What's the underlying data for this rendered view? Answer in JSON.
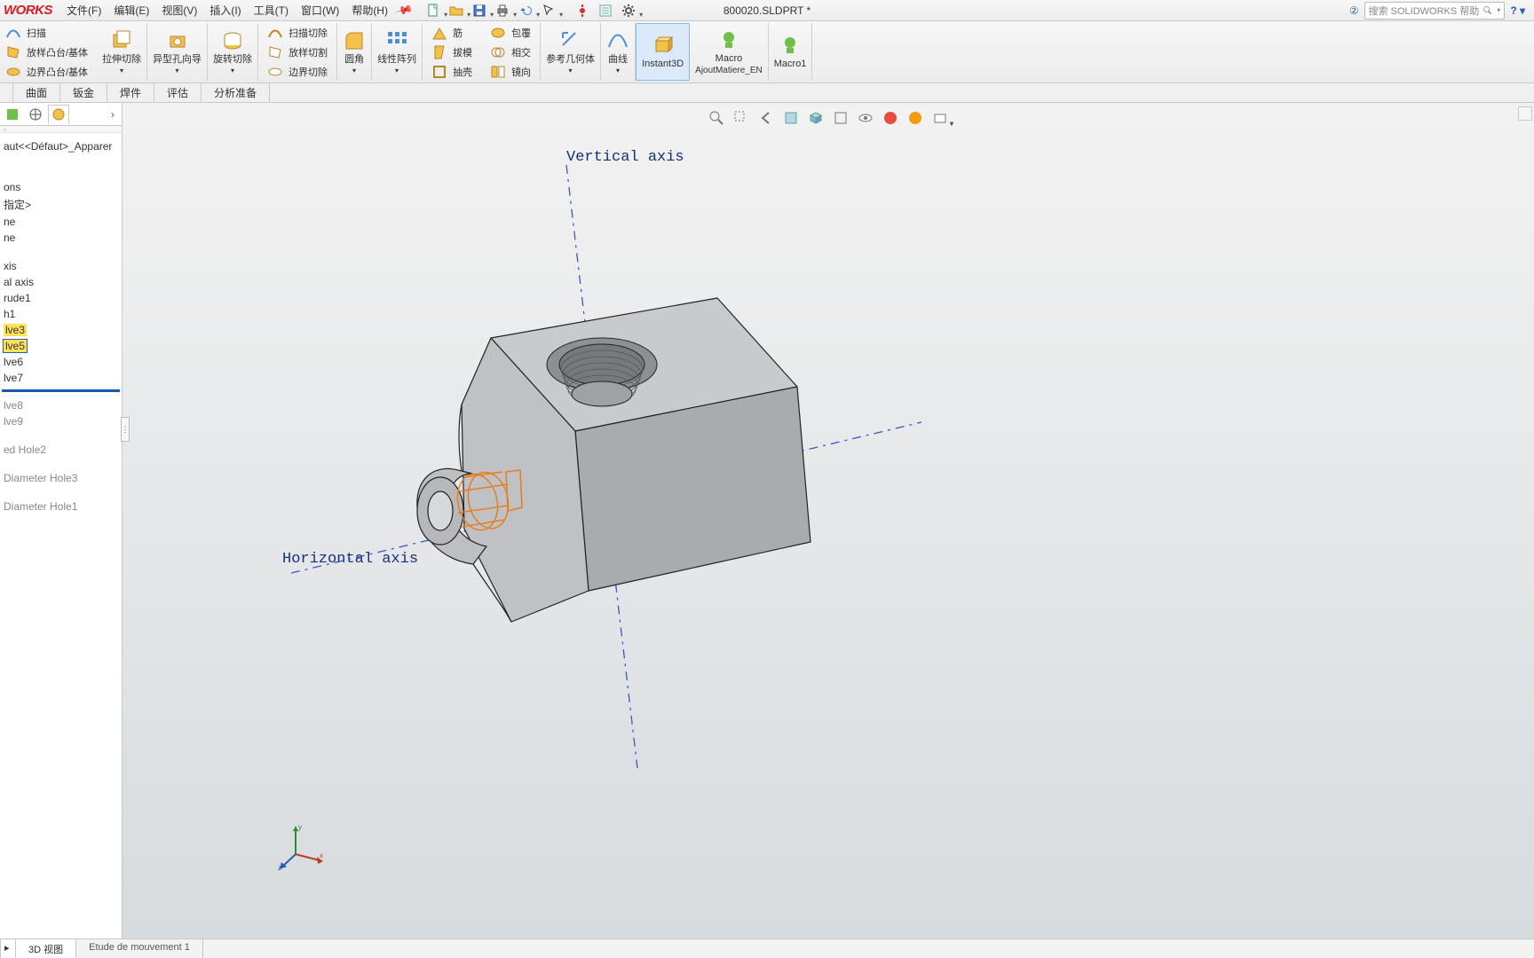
{
  "app": {
    "logo": "WORKS",
    "doc": "800020.SLDPRT *"
  },
  "menu": [
    "文件(F)",
    "编辑(E)",
    "视图(V)",
    "插入(I)",
    "工具(T)",
    "窗口(W)",
    "帮助(H)"
  ],
  "search": {
    "placeholder": "搜索 SOLIDWORKS 帮助"
  },
  "ribbon": {
    "col0": {
      "a": "扫描",
      "b": "放样凸台/基体",
      "c": "边界凸台/基体"
    },
    "col1": {
      "a": "拉伸切除"
    },
    "col2": {
      "a": "异型孔向导"
    },
    "col3": {
      "a": "旋转切除"
    },
    "col4": {
      "a": "扫描切除",
      "b": "放样切割",
      "c": "边界切除"
    },
    "col5": {
      "a": "圆角"
    },
    "col6": {
      "a": "线性阵列"
    },
    "col7": {
      "a": "筋",
      "b": "拔模",
      "c": "抽壳"
    },
    "col8": {
      "a": "包覆",
      "b": "相交",
      "c": "镜向"
    },
    "col9": {
      "a": "参考几何体"
    },
    "col10": {
      "a": "曲线"
    },
    "col11": {
      "a": "Instant3D"
    },
    "col12": {
      "a": "Macro",
      "b": "AjoutMatiere_EN"
    },
    "col13": {
      "a": "Macro1"
    }
  },
  "tabs": [
    "曲面",
    "钣金",
    "焊件",
    "评估",
    "分析准备"
  ],
  "sidebar": {
    "config": "aut<<Défaut>_Apparer",
    "items": [
      "ons",
      "指定>",
      "ne",
      "ne",
      "",
      "xis",
      "al axis",
      "rude1",
      "h1",
      "lve3",
      "lve5",
      "lve6",
      "lve7"
    ],
    "suppressed": [
      "lve8",
      "lve9",
      "",
      "ed Hole2",
      "",
      "Diameter Hole3",
      "",
      "Diameter Hole1"
    ]
  },
  "viewport": {
    "vaxis": "Vertical axis",
    "haxis": "Horizontal axis"
  },
  "bottom": {
    "a": "3D 视图",
    "b": "Etude de mouvement 1"
  }
}
